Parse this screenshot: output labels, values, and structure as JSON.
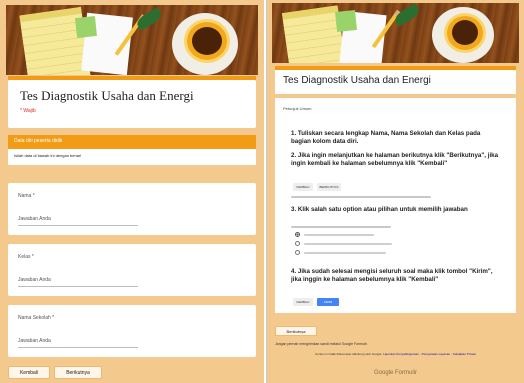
{
  "colors": {
    "accent": "#f29b15",
    "background": "#f3c98d",
    "button_blue": "#4285f4"
  },
  "left_form": {
    "title": "Tes Diagnostik Usaha dan Energi",
    "required_note": "* Wajib",
    "section_title": "Data diri peserta didik",
    "section_description": "Isilah data di bawah ini dengan benar!",
    "questions": [
      {
        "label": "Nama *",
        "placeholder": "Jawaban Anda"
      },
      {
        "label": "Kelas *",
        "placeholder": "Jawaban Anda"
      },
      {
        "label": "Nama Sekolah *",
        "placeholder": "Jawaban Anda"
      }
    ],
    "back_button": "Kembali",
    "next_button": "Berikutnya"
  },
  "right_form": {
    "title": "Tes Diagnostik Usaha dan Energi",
    "section_title": "Petunjuk Umum",
    "instructions": [
      "1. Tuliskan secara lengkap Nama, Nama Sekolah dan Kelas pada bagian kolom data diri.",
      "2. Jika ingin melanjutkan ke halaman berikutnya klik \"Berikutnya\", jika ingin kembali ke halaman sebelumnya klik \"Kembali\"",
      "3. Klik salah satu option atau pilihan untuk memilih jawaban",
      "4. Jika sudah selesai mengisi seluruh soal maka klik tombol \"Kirim\", jika inggin ke halaman sebelumnya klik \"Kembali\""
    ],
    "example_back": "KEMBALI",
    "example_next": "BERIKUTNYA",
    "example_back2": "KEMBALI",
    "example_submit": "KIRIM",
    "next_button": "Berikutnya",
    "never_submit": "Jangan pernah mengirimkan sandi melalui Google Formulir.",
    "footer_text": "Konten ini tidak dibuat atau didukung oleh Google.",
    "footer_links": [
      "Laporkan Penyalahgunaan",
      "Persyaratan Layanan",
      "Kebijakan Privasi"
    ],
    "brand": "Google Formulir"
  }
}
